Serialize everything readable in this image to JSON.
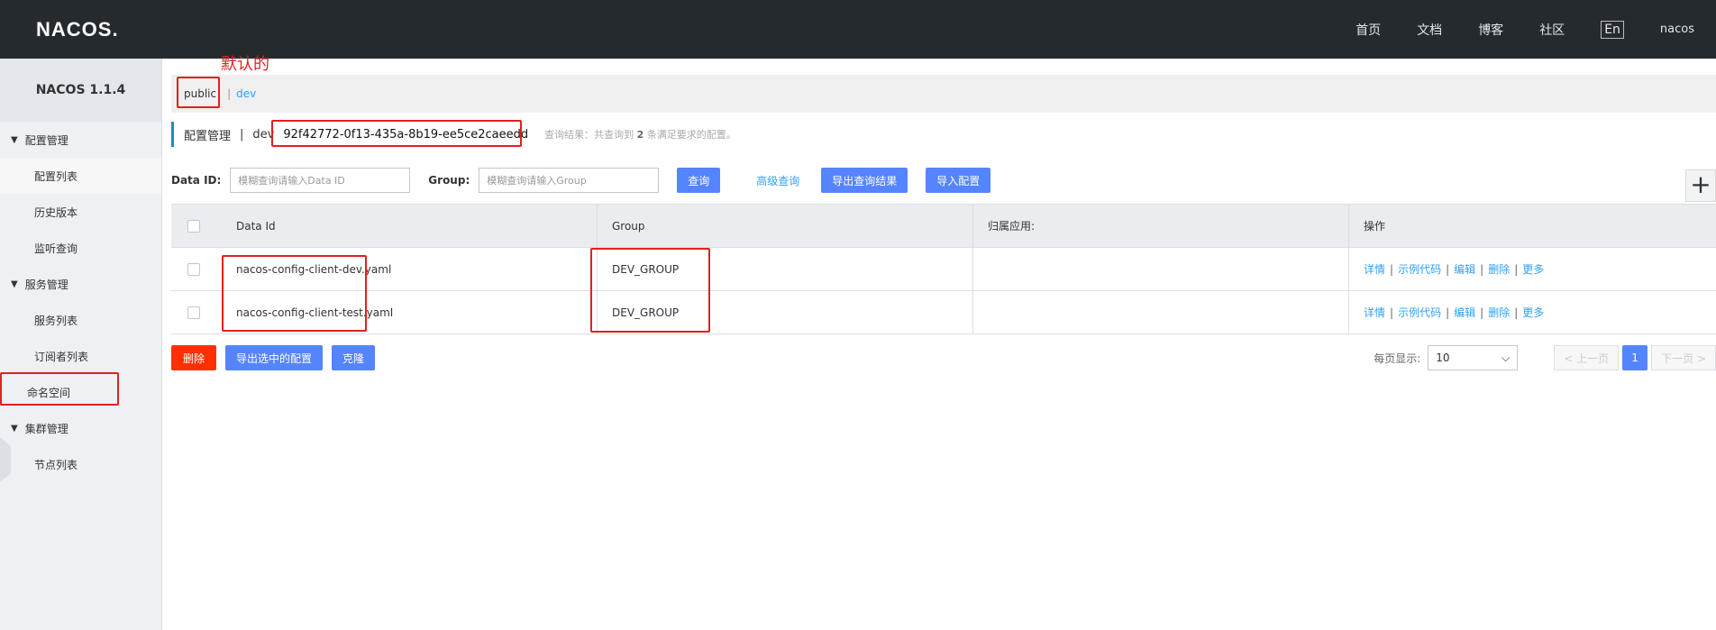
{
  "header": {
    "logo": "NACOS.",
    "nav": [
      "首页",
      "文档",
      "博客",
      "社区"
    ],
    "lang": "En",
    "user": "nacos"
  },
  "sidebar": {
    "title": "NACOS 1.1.4",
    "groups": [
      {
        "label": "配置管理",
        "items": [
          "配置列表",
          "历史版本",
          "监听查询"
        ]
      },
      {
        "label": "服务管理",
        "items": [
          "服务列表",
          "订阅者列表"
        ]
      },
      {
        "label": "命名空间"
      },
      {
        "label": "集群管理",
        "items": [
          "节点列表"
        ]
      }
    ]
  },
  "annotation": {
    "default_label": "默认的"
  },
  "namespace_bar": {
    "public": "public",
    "separator": "|",
    "dev": "dev"
  },
  "breadcrumb": {
    "title": "配置管理",
    "separator": "|",
    "ns": "dev",
    "ns_id": "92f42772-0f13-435a-8b19-ee5ce2caeedd",
    "result_prefix": "查询结果：共查询到",
    "result_count": "2",
    "result_suffix": "条满足要求的配置。"
  },
  "search": {
    "data_id_label": "Data ID:",
    "data_id_placeholder": "模糊查询请输入Data ID",
    "group_label": "Group:",
    "group_placeholder": "模糊查询请输入Group",
    "query_btn": "查询",
    "advanced": "高级查询",
    "export_results": "导出查询结果",
    "import_config": "导入配置",
    "plus": "+"
  },
  "table": {
    "columns": [
      "Data Id",
      "Group",
      "归属应用:",
      "操作"
    ],
    "rows": [
      {
        "data_id": "nacos-config-client-dev.yaml",
        "group": "DEV_GROUP",
        "app": ""
      },
      {
        "data_id": "nacos-config-client-test.yaml",
        "group": "DEV_GROUP",
        "app": ""
      }
    ],
    "ops": [
      "详情",
      "示例代码",
      "编辑",
      "删除",
      "更多"
    ]
  },
  "bottom": {
    "delete": "删除",
    "export_selected": "导出选中的配置",
    "clone": "克隆",
    "page_size_label": "每页显示:",
    "page_size": "10",
    "prev": "< 上一页",
    "current_page": "1",
    "next": "下一页 >"
  },
  "colors": {
    "primary": "#5584ff",
    "danger": "#ff3000",
    "link": "#2ea1ff",
    "annotation": "#e02020",
    "topbar": "#252a2f"
  }
}
